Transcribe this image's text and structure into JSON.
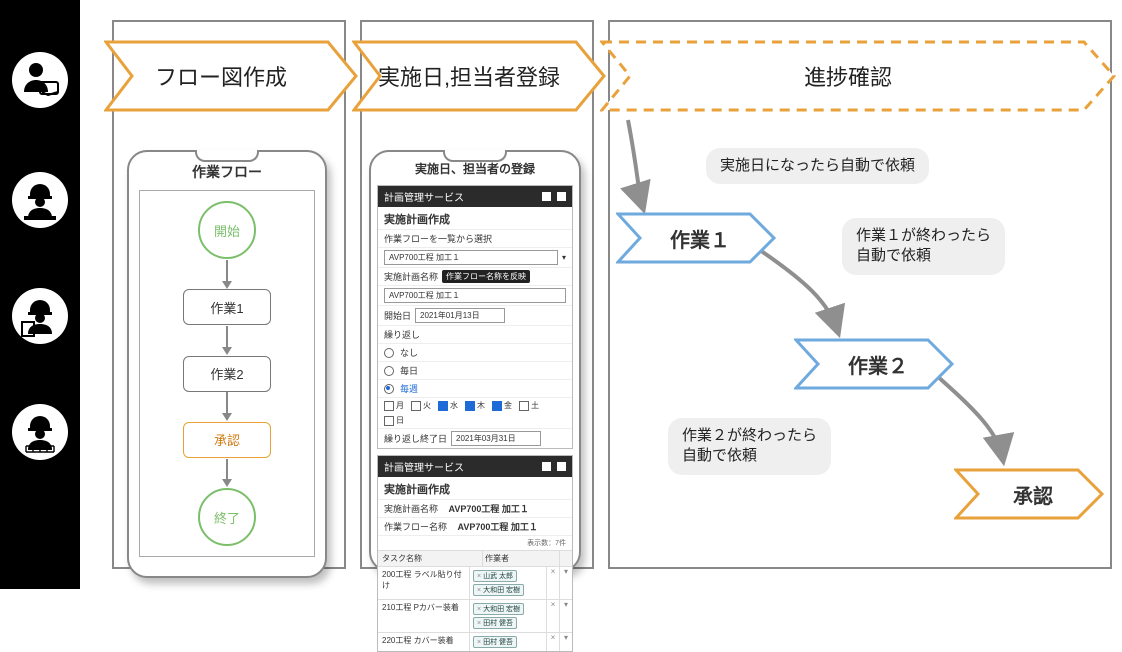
{
  "headers": {
    "h1": "フロー図作成",
    "h2": "実施日,担当者登録",
    "h3": "進捗確認"
  },
  "phone1": {
    "title": "作業フロー",
    "start": "開始",
    "s1": "作業1",
    "s2": "作業2",
    "approve": "承認",
    "end": "終了"
  },
  "phone2": {
    "title": "実施日、担当者の登録",
    "service": "計画管理サービス",
    "form_title": "実施計画作成",
    "flow_select_label": "作業フローを一覧から選択",
    "flow_select_value": "AVP700工程 加工１",
    "name_label": "実施計画名称",
    "apply_btn": "作業フロー名称を反映",
    "name_value": "AVP700工程 加工１",
    "start_label": "開始日",
    "start_value": "2021年01月13日",
    "repeat_label": "繰り返し",
    "r_none": "なし",
    "r_daily": "毎日",
    "r_weekly": "毎週",
    "days": [
      "月",
      "火",
      "水",
      "木",
      "金",
      "土",
      "日"
    ],
    "days_on": [
      false,
      false,
      true,
      true,
      true,
      false,
      false
    ],
    "end_label": "繰り返し終了日",
    "end_value": "2021年03月31日",
    "p2_name_label": "実施計画名称",
    "p2_name_value": "AVP700工程 加工１",
    "p2_flow_label": "作業フロー名称",
    "p2_flow_value": "AVP700工程 加工１",
    "task_col": "タスク名称",
    "upd_col": "作業者",
    "count_label": "表示数：7件",
    "tasks": [
      {
        "name": "200工程 ラベル貼り付け",
        "assignees": [
          "山武 太郎",
          "大和田 宏樹"
        ]
      },
      {
        "name": "210工程 Pカバー装着",
        "assignees": [
          "大和田 宏樹",
          "田村 健吾"
        ]
      },
      {
        "name": "220工程 カバー装着",
        "assignees": [
          "田村 健吾"
        ]
      }
    ]
  },
  "col3": {
    "c0": "実施日になったら自動で依頼",
    "task1": "作業１",
    "c1a": "作業１が終わったら",
    "c1b": "自動で依頼",
    "task2": "作業２",
    "c2a": "作業２が終わったら",
    "c2b": "自動で依頼",
    "approve": "承認"
  },
  "colors": {
    "orange": "#e9a23b",
    "blue": "#6faadf",
    "grey": "#8f8f8f"
  }
}
